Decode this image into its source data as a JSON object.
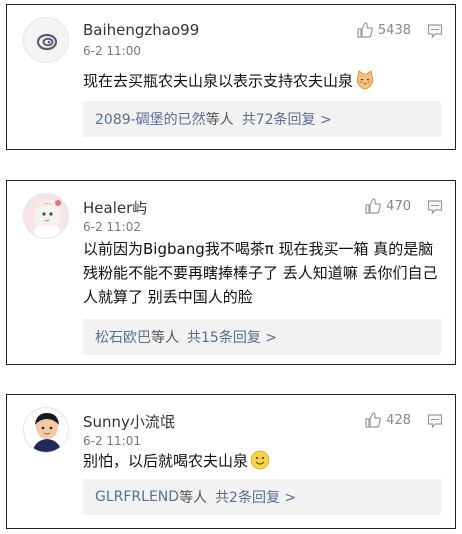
{
  "comments": [
    {
      "username": "Baihengzhao99",
      "time": "6-2 11:00",
      "likes": "5438",
      "text": "现在去买瓶农夫山泉以表示支持农夫山泉",
      "emoji_icon": "cat-face-emoji-icon",
      "reply_users": "2089-碉堡的已然",
      "reply_mid": "等人",
      "reply_count": "共72条回复 >"
    },
    {
      "username": "Healer屿",
      "time": "6-2 11:02",
      "likes": "470",
      "text": "以前因为Bigbang我不喝茶π 现在我买一箱 真的是脑残粉能不能不要再瞎捧棒子了 丢人知道嘛 丢你们自己人就算了 别丢中国人的脸",
      "reply_users": "松石欧巴",
      "reply_mid": "等人",
      "reply_count": "共15条回复 >"
    },
    {
      "username": "Sunny小流氓",
      "time": "6-2 11:01",
      "likes": "428",
      "text": "别怕，以后就喝农夫山泉",
      "emoji_icon": "smile-emoji-icon",
      "reply_users": "GLRFRLEND",
      "reply_mid": "等人",
      "reply_count": "共2条回复 >"
    }
  ]
}
